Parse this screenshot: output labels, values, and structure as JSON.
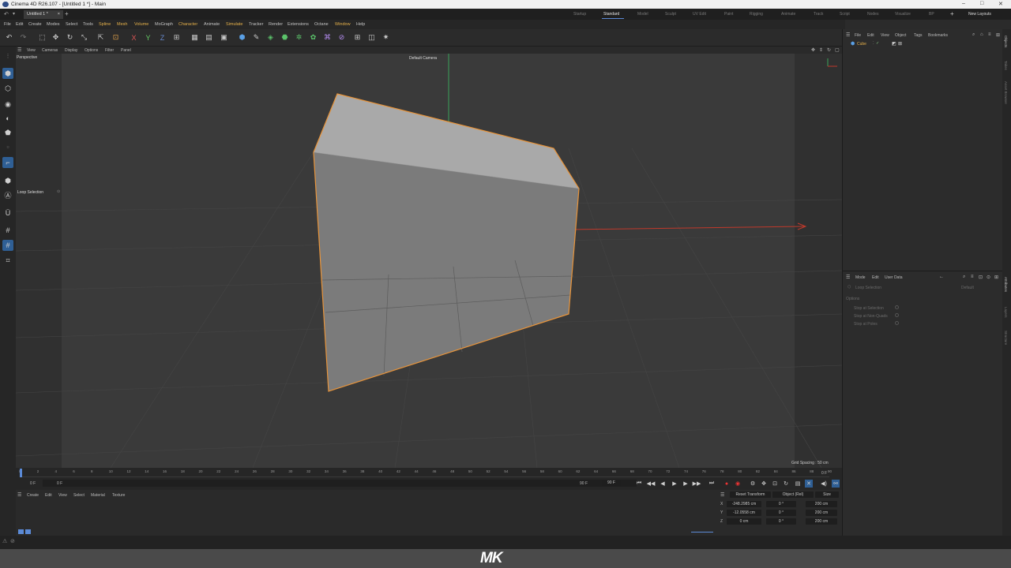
{
  "window": {
    "title": "Cinema 4D R26.107 - [Untitled 1 *] - Main",
    "controls": [
      "–",
      "□",
      "✕"
    ]
  },
  "doc_tab": {
    "label": "Untitled 1 *",
    "add": "+"
  },
  "layouts": {
    "items": [
      "Startup",
      "Standard",
      "Model",
      "Sculpt",
      "UV Edit",
      "Paint",
      "Rigging",
      "Animate",
      "Track",
      "Script",
      "Nodes",
      "Visualize",
      "BP"
    ],
    "active": "Standard",
    "add": "+",
    "new_layouts": "New Layouts"
  },
  "menu": {
    "items": [
      "File",
      "Edit",
      "Create",
      "Modes",
      "Select",
      "Tools",
      "Spline",
      "Mesh",
      "Volume",
      "MoGraph",
      "Character",
      "Animate",
      "Simulate",
      "Tracker",
      "Render",
      "Extensions",
      "Octane",
      "Window",
      "Help"
    ]
  },
  "viewport": {
    "menu": [
      "View",
      "Cameras",
      "Display",
      "Options",
      "Filter",
      "Panel"
    ],
    "name": "Perspective",
    "camera": "Default Camera",
    "grid_spacing": "Grid Spacing : 50 cm",
    "tool_label": "Loop Selection"
  },
  "timeline": {
    "ticks": [
      "0",
      "2",
      "4",
      "6",
      "8",
      "10",
      "12",
      "14",
      "16",
      "18",
      "20",
      "22",
      "24",
      "26",
      "28",
      "30",
      "32",
      "34",
      "36",
      "38",
      "40",
      "42",
      "44",
      "46",
      "48",
      "50",
      "52",
      "54",
      "56",
      "58",
      "60",
      "62",
      "64",
      "66",
      "68",
      "70",
      "72",
      "74",
      "76",
      "78",
      "80",
      "82",
      "84",
      "86",
      "88",
      "90"
    ],
    "current_frame": "0 F",
    "start": "0 F",
    "end_field": "90 F",
    "end_field2": "90 F",
    "right_frame": "0 F"
  },
  "material_manager": {
    "menu": [
      "Create",
      "Edit",
      "View",
      "Select",
      "Material",
      "Texture"
    ]
  },
  "coordinates": {
    "mode": "Reset Transform",
    "space": "Object (Rel)",
    "size": "Size",
    "rows": [
      {
        "axis": "X",
        "pos": "-248.2985 cm",
        "rot": "0 °",
        "size": "200 cm"
      },
      {
        "axis": "Y",
        "pos": "-12.0558 cm",
        "rot": "0 °",
        "size": "200 cm"
      },
      {
        "axis": "Z",
        "pos": "0 cm",
        "rot": "0 °",
        "size": "200 cm"
      }
    ]
  },
  "object_manager": {
    "menu": [
      "File",
      "Edit",
      "View",
      "Object",
      "Tags",
      "Bookmarks"
    ],
    "object": "Cube"
  },
  "attributes": {
    "menu": [
      "Mode",
      "Edit",
      "User Data"
    ],
    "tool": "Loop Selection",
    "preset": "Default",
    "section": "Options",
    "options": [
      "Stop at Selection",
      "Stop at Non-Quads",
      "Stop at Poles"
    ]
  },
  "side_tabs": {
    "top": [
      "Objects",
      "Takes",
      "Asset Browser"
    ],
    "bottom": [
      "Attributes",
      "Layers",
      "Structure"
    ]
  },
  "footer": {
    "logo": "MK"
  },
  "colors": {
    "accent": "#2f5f95",
    "selection": "#e8943a",
    "x_axis": "#c0392b",
    "y_axis": "#3aa35a",
    "playhead": "#5b8ad6",
    "record": "#d33"
  }
}
